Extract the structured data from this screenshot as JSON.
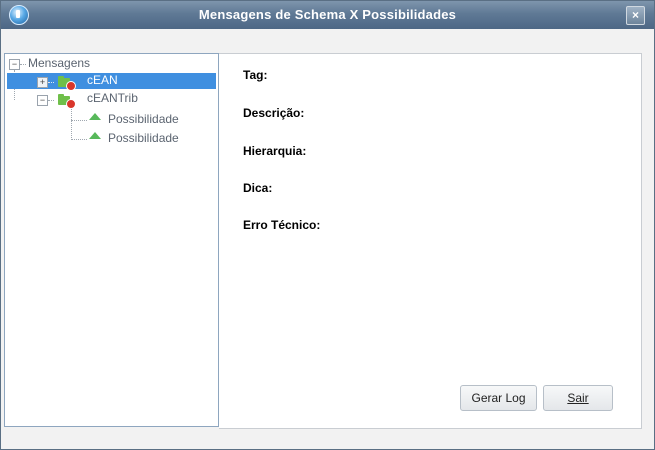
{
  "window": {
    "title": "Mensagens de Schema X Possibilidades",
    "close_glyph": "×"
  },
  "tree": {
    "root": "Mensagens",
    "items": [
      {
        "label": "cEAN",
        "expander": "+",
        "icon": "folder-error-icon",
        "selected": true
      },
      {
        "label": "cEANTrib",
        "expander": "−",
        "icon": "folder-error-icon",
        "selected": false,
        "children": [
          {
            "label": "Possibilidade",
            "icon": "triangle-icon"
          },
          {
            "label": "Possibilidade",
            "icon": "triangle-icon"
          }
        ]
      }
    ]
  },
  "details": {
    "tag_label": "Tag:",
    "descricao_label": "Descrição:",
    "hierarquia_label": "Hierarquia:",
    "dica_label": "Dica:",
    "erro_label": "Erro Técnico:"
  },
  "buttons": {
    "gerar_log": "Gerar Log",
    "sair": "Sair"
  },
  "colors": {
    "titlebar": "#5f7995",
    "selection": "#3f8fe0",
    "folder": "#6fbf4a",
    "error": "#d9362b",
    "possibility": "#57b85a"
  }
}
